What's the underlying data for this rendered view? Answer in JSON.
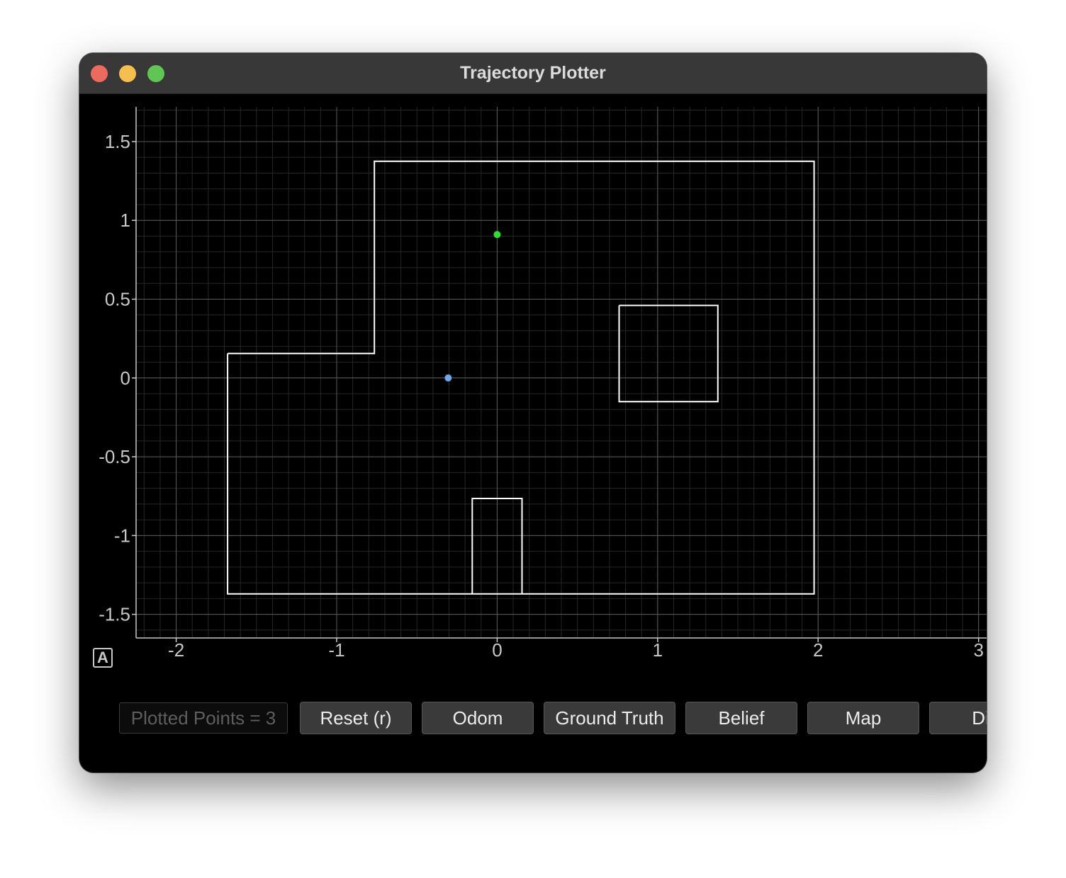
{
  "window": {
    "title": "Trajectory Plotter"
  },
  "plot": {
    "background": "#000000",
    "axis_color": "#c8c8c8",
    "wall_color": "#ffffff",
    "xlim": [
      -2.25,
      3.05
    ],
    "ylim": [
      -1.65,
      1.72
    ],
    "x_ticks": [
      "-2",
      "-1",
      "0",
      "1",
      "2",
      "3"
    ],
    "y_ticks": [
      "1.5",
      "1",
      "0.5",
      "0",
      "-0.5",
      "-1",
      "-1.5"
    ],
    "grid": true,
    "auto_range_label": "A"
  },
  "map": {
    "walls": [
      [
        [
          -1.68,
          0.155
        ],
        [
          -0.765,
          0.155
        ],
        [
          -0.765,
          1.375
        ],
        [
          1.975,
          1.375
        ],
        [
          1.975,
          -1.37
        ],
        [
          -1.68,
          -1.37
        ],
        [
          -1.68,
          0.155
        ]
      ],
      [
        [
          0.76,
          0.46
        ],
        [
          1.375,
          0.46
        ],
        [
          1.375,
          -0.15
        ],
        [
          0.76,
          -0.15
        ],
        [
          0.76,
          0.46
        ]
      ],
      [
        [
          -0.155,
          -1.37
        ],
        [
          -0.155,
          -0.765
        ],
        [
          0.155,
          -0.765
        ],
        [
          0.155,
          -1.37
        ]
      ]
    ]
  },
  "points": [
    {
      "series": "ground-truth",
      "x": 0.0,
      "y": 0.91,
      "color": "#2ee02e"
    },
    {
      "series": "odom",
      "x": -0.305,
      "y": 0.0,
      "color": "#6ea8e8"
    }
  ],
  "toolbar": {
    "plotted_points": "Plotted Points = 3",
    "reset_label": "Reset (r)",
    "odom_label": "Odom",
    "ground_truth_label": "Ground Truth",
    "belief_label": "Belief",
    "map_label": "Map",
    "dist_label": "Dis"
  }
}
